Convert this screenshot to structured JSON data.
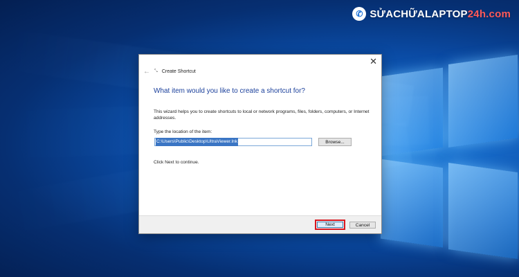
{
  "watermark": {
    "text_main": "SỬACHỮALAPTOP",
    "text_accent": "24h.com",
    "icon": "phone-icon"
  },
  "dialog": {
    "title": "Create Shortcut",
    "heading": "What item would you like to create a shortcut for?",
    "description": "This wizard helps you to create shortcuts to local or network programs, files, folders, computers, or Internet addresses.",
    "location_label": "Type the location of the item:",
    "location_value": "C:\\Users\\Public\\Desktop\\UltraViewer.lnk",
    "browse_label": "Browse...",
    "continue_text": "Click Next to continue.",
    "next_label": "Next",
    "cancel_label": "Cancel"
  },
  "colors": {
    "heading_blue": "#1a3f9b",
    "highlight_red": "#d8171f",
    "desktop_blue": "#0a4aa3"
  }
}
